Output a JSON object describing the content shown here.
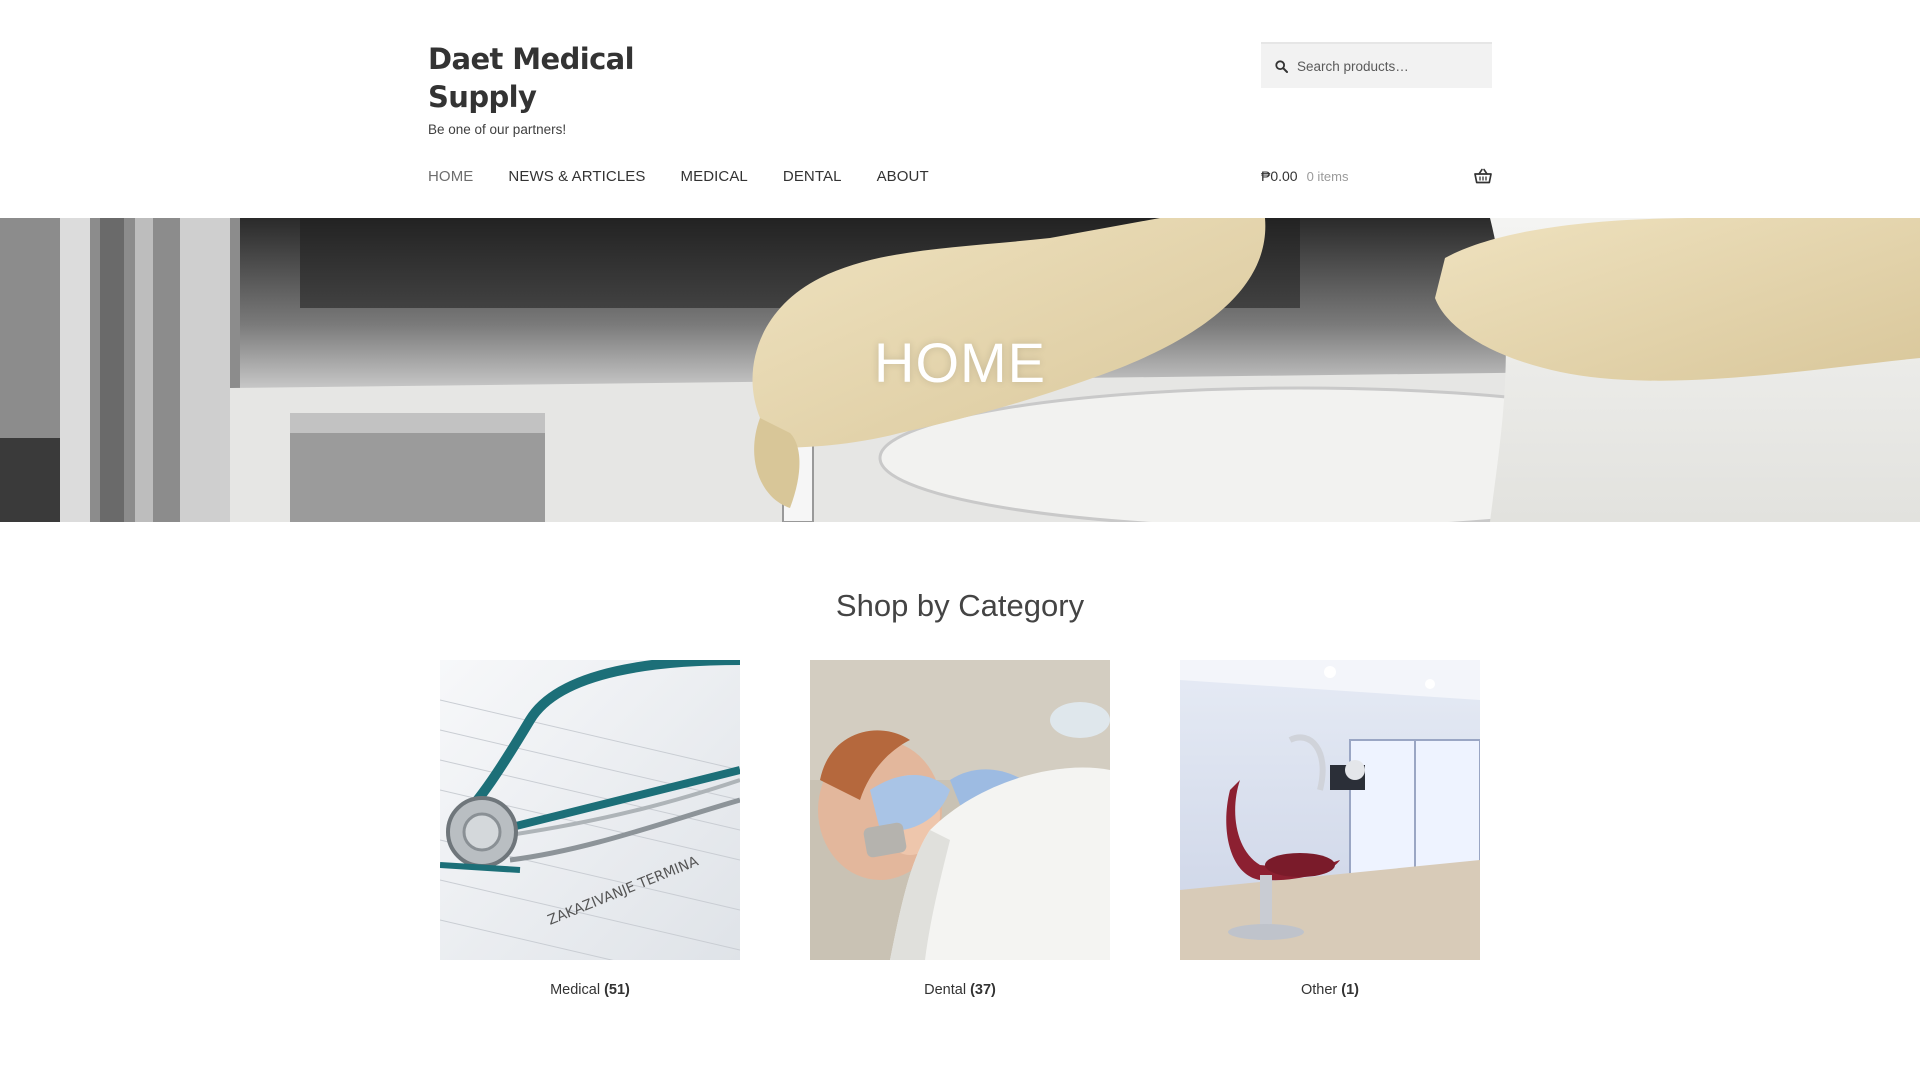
{
  "site": {
    "title": "Daet Medical Supply",
    "tagline": "Be one of our partners!"
  },
  "search": {
    "placeholder": "Search products…",
    "value": ""
  },
  "nav": {
    "items": [
      {
        "label": "HOME",
        "active": true
      },
      {
        "label": "NEWS & ARTICLES",
        "active": false
      },
      {
        "label": "MEDICAL",
        "active": false
      },
      {
        "label": "DENTAL",
        "active": false
      },
      {
        "label": "ABOUT",
        "active": false
      }
    ]
  },
  "cart": {
    "amount": "₱0.00",
    "count": "0 items"
  },
  "hero": {
    "title": "HOME"
  },
  "categories": {
    "heading": "Shop by Category",
    "items": [
      {
        "name": "Medical",
        "count": "(51)",
        "image": "stethoscope-on-chart"
      },
      {
        "name": "Dental",
        "count": "(37)",
        "image": "child-dental-exam"
      },
      {
        "name": "Other",
        "count": "(1)",
        "image": "dental-clinic-room"
      }
    ]
  },
  "colors": {
    "text": "#333333",
    "muted": "#9a9a9a",
    "search_bg": "#f2f2f2",
    "hero_text": "#ffffff"
  },
  "icons": {
    "search": "search-icon",
    "cart": "basket-icon"
  }
}
